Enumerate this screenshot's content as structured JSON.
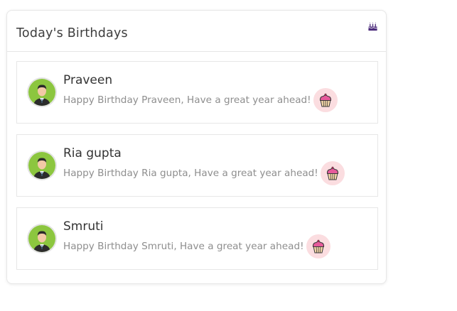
{
  "widget": {
    "title": "Today's Birthdays",
    "header_icon": "birthday-cake-icon"
  },
  "birthdays": [
    {
      "name": "Praveen",
      "message": "Happy Birthday Praveen, Have a great year ahead!",
      "icon": "cupcake-icon"
    },
    {
      "name": "Ria gupta",
      "message": "Happy Birthday Ria gupta, Have a great year ahead!",
      "icon": "cupcake-icon"
    },
    {
      "name": "Smruti",
      "message": "Happy Birthday Smruti, Have a great year ahead!",
      "icon": "cupcake-icon"
    }
  ],
  "colors": {
    "accent": "#4b2a7b",
    "cupcake_bg": "#fbdde0",
    "avatar_bg": "#8cc63f"
  }
}
